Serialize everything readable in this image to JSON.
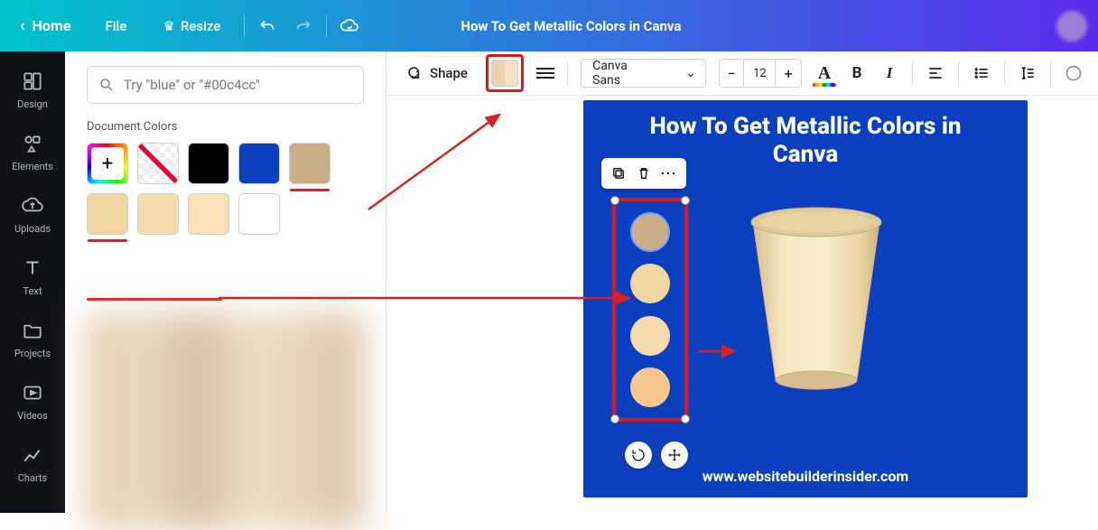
{
  "header": {
    "home": "Home",
    "file": "File",
    "resize": "Resize",
    "doc_title": "How To Get Metallic Colors in Canva"
  },
  "rail": {
    "design": "Design",
    "elements": "Elements",
    "uploads": "Uploads",
    "text": "Text",
    "projects": "Projects",
    "videos": "Videos",
    "charts": "Charts"
  },
  "panel": {
    "search_placeholder": "Try \"blue\" or \"#00c4cc\"",
    "doc_colors_label": "Document Colors",
    "swatches": [
      {
        "name": "add",
        "color": "add"
      },
      {
        "name": "transparent",
        "color": "checker"
      },
      {
        "name": "black",
        "color": "#000000"
      },
      {
        "name": "blue",
        "color": "#0a3fbf"
      },
      {
        "name": "tan",
        "color": "#c9ae86"
      },
      {
        "name": "peach",
        "color": "#f2d6a2"
      },
      {
        "name": "lightpeach1",
        "color": "#f6dcad"
      },
      {
        "name": "lightpeach2",
        "color": "#f8e3b7"
      },
      {
        "name": "white",
        "color": "#ffffff"
      }
    ]
  },
  "toolbar": {
    "shape_label": "Shape",
    "font_name": "Canva Sans",
    "font_size": "12",
    "minus": "−",
    "plus": "+",
    "A": "A",
    "B": "B",
    "I": "I"
  },
  "canvas": {
    "title_line1": "How To Get Metallic Colors in",
    "title_line2": "Canva",
    "url": "www.websitebuilderinsider.com",
    "selected_circles": [
      "#c9ae86",
      "#f2d6a2",
      "#f6dcad",
      "#f8c88a"
    ]
  }
}
